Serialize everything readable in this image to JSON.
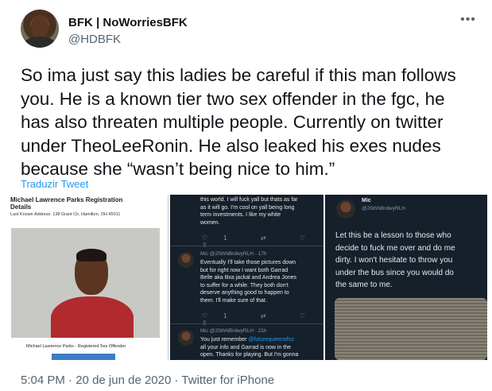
{
  "tweet": {
    "display_name": "BFK | NoWorriesBFK",
    "handle": "@HDBFK",
    "more_icon": "more-horizontal-icon",
    "text": "So ima just say this ladies be careful if this man follows\nyou. He is a known tier two sex offender in the fgc, he\nhas also threaten multiple people. Currently on twitter\nunder TheoLeeRonin. He also leaked his exes nudes\nbecause she “wasn’t being nice to him.”",
    "translate_label": "Traduzir Tweet",
    "time": "5:04 PM",
    "dot1": "·",
    "date": "20 de jun de 2020",
    "dot2": "·",
    "source": "Twitter for iPhone"
  },
  "media": {
    "panel1": {
      "title": "Michael Lawrence Parks Registration\nDetails",
      "address": "Last Known Address: 138 Grant Cir, Hamilton, OH 45011",
      "caption": "Michael Lawrence Parks - Registered Sex Offender"
    },
    "panel2": {
      "top_text": "this world. I will fuck yall but thats as far\nas it will go. I'm cool on yall being long\nterm investments. I like my white\nwomen.",
      "top_icons": "♡1 ⇄ ♡ ⇪",
      "reply1_header": "Mic @25thNBrdwyRLH · 17h",
      "reply1_text": "Eventually I'll take those pictures down\nbut for right now I want both Garrad\nBelle aka Bxa jackal and Andrea Jones\nto suffer for a while. They both don't\ndeserve anything good to happen to\nthem. I'll make sure of that.",
      "reply1_icons": "♡1 ⇄ ♡ ⇪",
      "reply2_header": "Mic @25thNBrdwyRLH · 21h",
      "reply2_text_start": "You just remember ",
      "reply2_mention": "@futurequeenofoz",
      "reply2_text_rest": "all your info and Garrad is now in the\nopen. Thanks for playing. But I'm gonna"
    },
    "panel3": {
      "name": "Mic",
      "handle": "@25thNBrdwyRLH",
      "text": "Let this be a lesson to those who\ndecide to fuck me over and do me\ndirty. I won't hesitate to throw you\nunder the bus since you would do\nthe same to me."
    }
  },
  "colors": {
    "text": "#0f1419",
    "muted": "#536471",
    "link": "#1d9bf0",
    "dark_bg": "#15202b"
  }
}
